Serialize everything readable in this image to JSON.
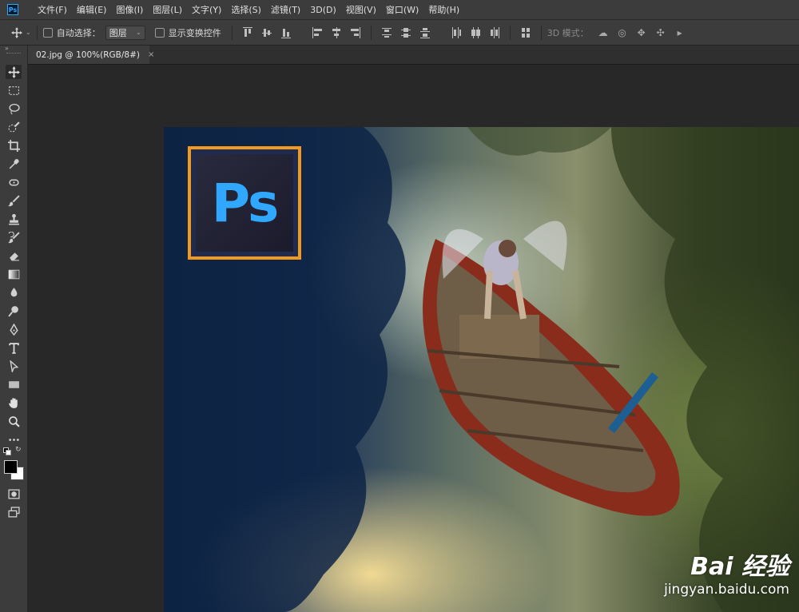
{
  "app": {
    "logo": "Ps"
  },
  "menu": [
    "文件(F)",
    "编辑(E)",
    "图像(I)",
    "图层(L)",
    "文字(Y)",
    "选择(S)",
    "滤镜(T)",
    "3D(D)",
    "视图(V)",
    "窗口(W)",
    "帮助(H)"
  ],
  "options": {
    "auto_select_label": "自动选择：",
    "auto_select_value": "图层",
    "transform_controls_label": "显示变换控件",
    "mode_3d_label": "3D 模式："
  },
  "document": {
    "tab_title": "02.jpg @ 100%(RGB/8#)",
    "close_glyph": "×"
  },
  "canvas": {
    "logo_text": "Ps",
    "watermark_brand": "Bai 经验",
    "watermark_url": "jingyan.baidu.com"
  },
  "colors": {
    "ps_blue": "#31a8ff",
    "logo_border": "#f29a1f",
    "ui_panel": "#3c3c3c"
  },
  "toolbar": {
    "tools": [
      "move-tool",
      "marquee-tool",
      "lasso-tool",
      "quick-select-tool",
      "crop-tool",
      "eyedropper-tool",
      "healing-brush-tool",
      "brush-tool",
      "clone-stamp-tool",
      "history-brush-tool",
      "eraser-tool",
      "gradient-tool",
      "blur-tool",
      "dodge-tool",
      "pen-tool",
      "type-tool",
      "path-select-tool",
      "rectangle-tool",
      "hand-tool",
      "zoom-tool",
      "more-tools",
      "swap-colors",
      "foreground-background-colors",
      "quick-mask-mode",
      "screen-mode"
    ]
  }
}
